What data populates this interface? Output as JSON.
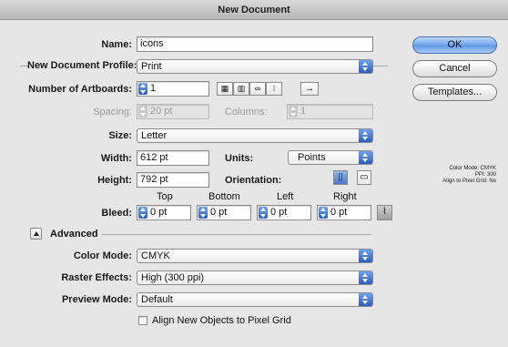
{
  "window": {
    "title": "New Document"
  },
  "name": {
    "label": "Name:",
    "value": "icons"
  },
  "profile": {
    "label": "New Document Profile:",
    "value": "Print"
  },
  "artboards": {
    "label": "Number of Artboards:",
    "value": "1",
    "spacing_label": "Spacing:",
    "spacing_value": "20 pt",
    "columns_label": "Columns:",
    "columns_value": "1",
    "arrow_glyph": "→"
  },
  "size": {
    "label": "Size:",
    "value": "Letter"
  },
  "width": {
    "label": "Width:",
    "value": "612 pt"
  },
  "units": {
    "label": "Units:",
    "value": "Points"
  },
  "height": {
    "label": "Height:",
    "value": "792 pt"
  },
  "orientation": {
    "label": "Orientation:"
  },
  "bleed": {
    "label": "Bleed:",
    "top_label": "Top",
    "top_value": "0 pt",
    "bottom_label": "Bottom",
    "bottom_value": "0 pt",
    "left_label": "Left",
    "left_value": "0 pt",
    "right_label": "Right",
    "right_value": "0 pt"
  },
  "advanced": {
    "label": "Advanced",
    "color_mode_label": "Color Mode:",
    "color_mode_value": "CMYK",
    "raster_label": "Raster Effects:",
    "raster_value": "High (300 ppi)",
    "preview_label": "Preview Mode:",
    "preview_value": "Default",
    "align_label": "Align New Objects to Pixel Grid"
  },
  "buttons": {
    "ok": "OK",
    "cancel": "Cancel",
    "templates": "Templates..."
  },
  "info": {
    "line1": "Color Mode: CMYK",
    "line2": "PPI: 300",
    "line3": "Align to Pixel Grid: No"
  },
  "icons": [
    "grid-by-row-icon",
    "grid-by-column-icon",
    "arrange-by-row-icon",
    "arrange-by-column-icon",
    "right-to-left-icon",
    "portrait-icon",
    "landscape-icon",
    "link-bleed-icon"
  ]
}
